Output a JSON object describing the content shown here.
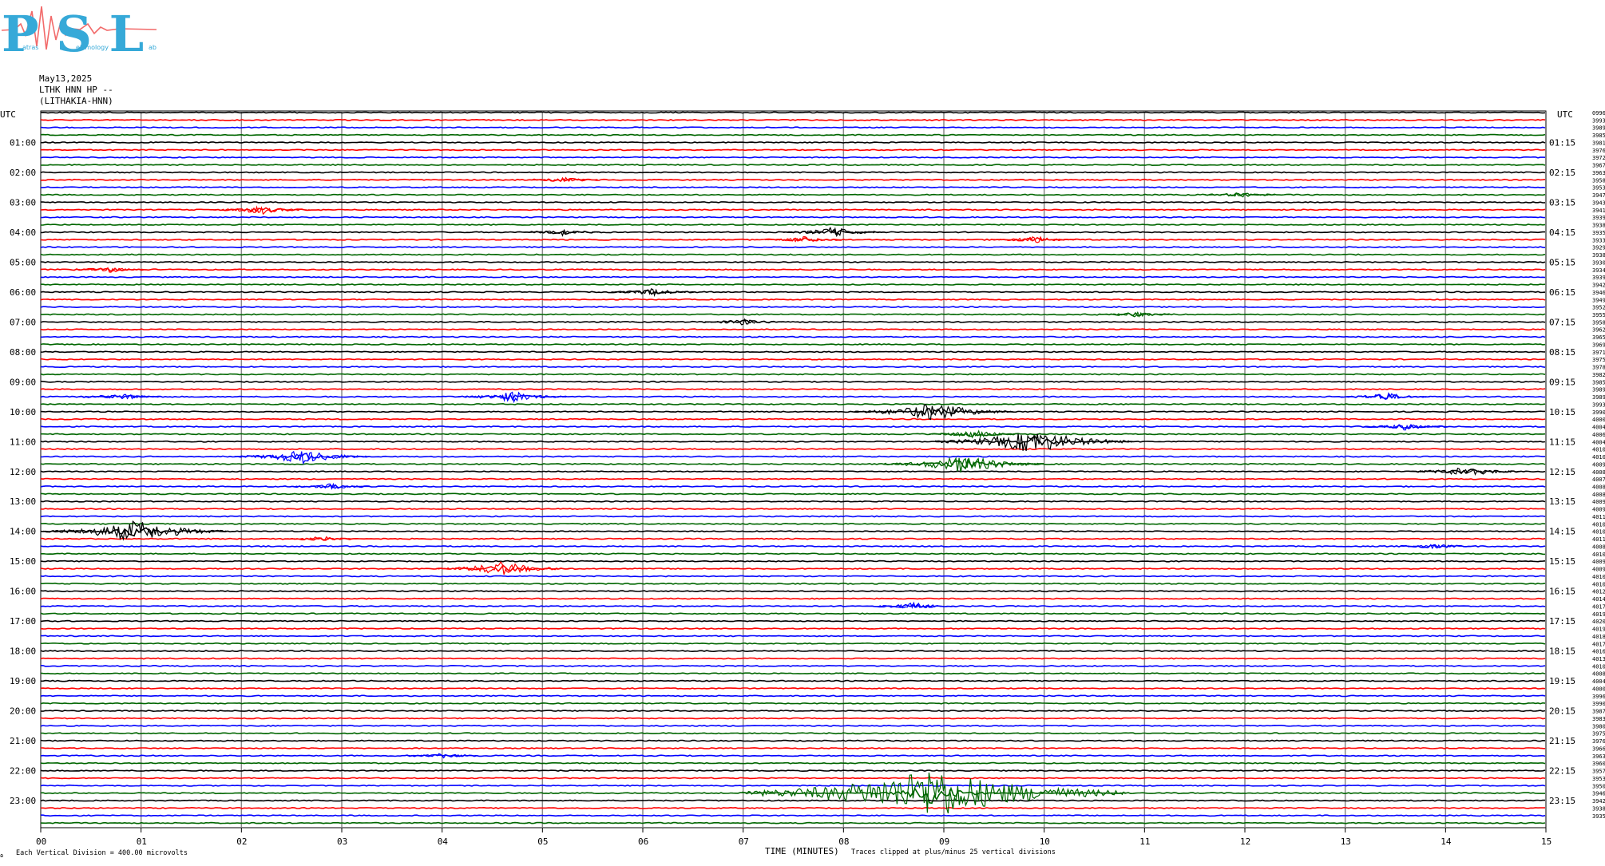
{
  "logo": {
    "text": "PSL",
    "small_text": [
      "atras",
      "eismology",
      "ab"
    ],
    "colors": {
      "letters": "#36a9d8",
      "trace": "#f26a6a"
    }
  },
  "header": {
    "date": "May13,2025",
    "station": "LTHK HNN HP --",
    "location": "(LITHAKIA-HNN)"
  },
  "utc_label": "UTC",
  "footer": {
    "time_label": "TIME (MINUTES)",
    "vertical_division": "Each Vertical Division =  400.00 microvolts",
    "clipping": "Traces clipped at plus/minus 25 vertical divisions",
    "corner_mark": "ɷ"
  },
  "colors": {
    "cycle": [
      "#000000",
      "#ff0000",
      "#0000ff",
      "#006600"
    ],
    "grid": "#8a8a8a"
  },
  "chart_data": {
    "type": "helicorder",
    "xlabel": "TIME (MINUTES)",
    "xlim": [
      0,
      15
    ],
    "x_ticks": [
      "00",
      "01",
      "02",
      "03",
      "04",
      "05",
      "06",
      "07",
      "08",
      "09",
      "10",
      "11",
      "12",
      "13",
      "14",
      "15"
    ],
    "line_minutes": 15,
    "trace_count": 96,
    "trace_color_cycle": [
      "black",
      "red",
      "blue",
      "green"
    ],
    "left_hour_labels": [
      "01:00",
      "02:00",
      "03:00",
      "04:00",
      "05:00",
      "06:00",
      "07:00",
      "08:00",
      "09:00",
      "10:00",
      "11:00",
      "12:00",
      "13:00",
      "14:00",
      "15:00",
      "16:00",
      "17:00",
      "18:00",
      "19:00",
      "20:00",
      "21:00",
      "22:00",
      "23:00"
    ],
    "right_hour_labels": [
      "01:15",
      "02:15",
      "03:15",
      "04:15",
      "05:15",
      "06:15",
      "07:15",
      "08:15",
      "09:15",
      "10:15",
      "11:15",
      "12:15",
      "13:15",
      "14:15",
      "15:15",
      "16:15",
      "17:15",
      "18:15",
      "19:15",
      "20:15",
      "21:15",
      "22:15",
      "23:15"
    ],
    "right_values": [
      "0996",
      "3993",
      "3989",
      "3985",
      "3981",
      "3976",
      "3972",
      "3967",
      "3963",
      "3958",
      "3953",
      "3947",
      "3943",
      "3941",
      "3939",
      "3938",
      "3935",
      "3933",
      "3929",
      "3938",
      "3930",
      "3934",
      "3939",
      "3942",
      "3946",
      "3949",
      "3952",
      "3955",
      "3958",
      "3962",
      "3965",
      "3969",
      "3971",
      "3975",
      "3978",
      "3982",
      "3985",
      "3989",
      "3989",
      "3993",
      "3990",
      "4000",
      "4004",
      "4006",
      "4004",
      "4010",
      "4010",
      "4009",
      "4008",
      "4007",
      "4008",
      "4008",
      "4009",
      "4009",
      "4011",
      "4010",
      "4010",
      "4011",
      "4008",
      "4010",
      "4009",
      "4009",
      "4010",
      "4010",
      "4012",
      "4014",
      "4017",
      "4019",
      "4020",
      "4019",
      "4018",
      "4017",
      "4016",
      "4013",
      "4010",
      "4008",
      "4004",
      "4000",
      "3996",
      "3990",
      "3987",
      "3983",
      "3980",
      "3975",
      "3976",
      "3966",
      "3963",
      "3960",
      "3957",
      "3953",
      "3950",
      "3946",
      "3942",
      "3938",
      "3935"
    ],
    "events": [
      {
        "line": 9,
        "minute": 5.2,
        "amplitude": 0.6
      },
      {
        "line": 11,
        "minute": 11.95,
        "amplitude": 0.6
      },
      {
        "line": 13,
        "minute": 2.2,
        "amplitude": 1.0
      },
      {
        "line": 16,
        "minute": 7.9,
        "amplitude": 1.1
      },
      {
        "line": 16,
        "minute": 5.2,
        "amplitude": 0.7
      },
      {
        "line": 17,
        "minute": 7.6,
        "amplitude": 0.7
      },
      {
        "line": 17,
        "minute": 9.9,
        "amplitude": 0.8
      },
      {
        "line": 21,
        "minute": 0.7,
        "amplitude": 0.6
      },
      {
        "line": 24,
        "minute": 6.1,
        "amplitude": 0.8
      },
      {
        "line": 27,
        "minute": 10.9,
        "amplitude": 0.6
      },
      {
        "line": 28,
        "minute": 7.0,
        "amplitude": 0.7
      },
      {
        "line": 38,
        "minute": 0.8,
        "amplitude": 0.8
      },
      {
        "line": 38,
        "minute": 4.7,
        "amplitude": 1.2
      },
      {
        "line": 38,
        "minute": 13.4,
        "amplitude": 0.9
      },
      {
        "line": 40,
        "minute": 8.9,
        "amplitude": 2.0
      },
      {
        "line": 42,
        "minute": 13.6,
        "amplitude": 0.8
      },
      {
        "line": 43,
        "minute": 9.3,
        "amplitude": 0.9
      },
      {
        "line": 44,
        "minute": 9.9,
        "amplitude": 2.6
      },
      {
        "line": 46,
        "minute": 2.6,
        "amplitude": 1.6
      },
      {
        "line": 47,
        "minute": 9.2,
        "amplitude": 2.0
      },
      {
        "line": 48,
        "minute": 14.2,
        "amplitude": 1.2
      },
      {
        "line": 50,
        "minute": 2.9,
        "amplitude": 0.7
      },
      {
        "line": 56,
        "minute": 0.95,
        "amplitude": 2.4
      },
      {
        "line": 57,
        "minute": 2.8,
        "amplitude": 0.6
      },
      {
        "line": 58,
        "minute": 13.9,
        "amplitude": 0.6
      },
      {
        "line": 61,
        "minute": 4.6,
        "amplitude": 1.6
      },
      {
        "line": 66,
        "minute": 8.7,
        "amplitude": 0.8
      },
      {
        "line": 86,
        "minute": 4.0,
        "amplitude": 0.6
      },
      {
        "line": 91,
        "minute": 8.9,
        "amplitude": 5.5
      }
    ]
  }
}
